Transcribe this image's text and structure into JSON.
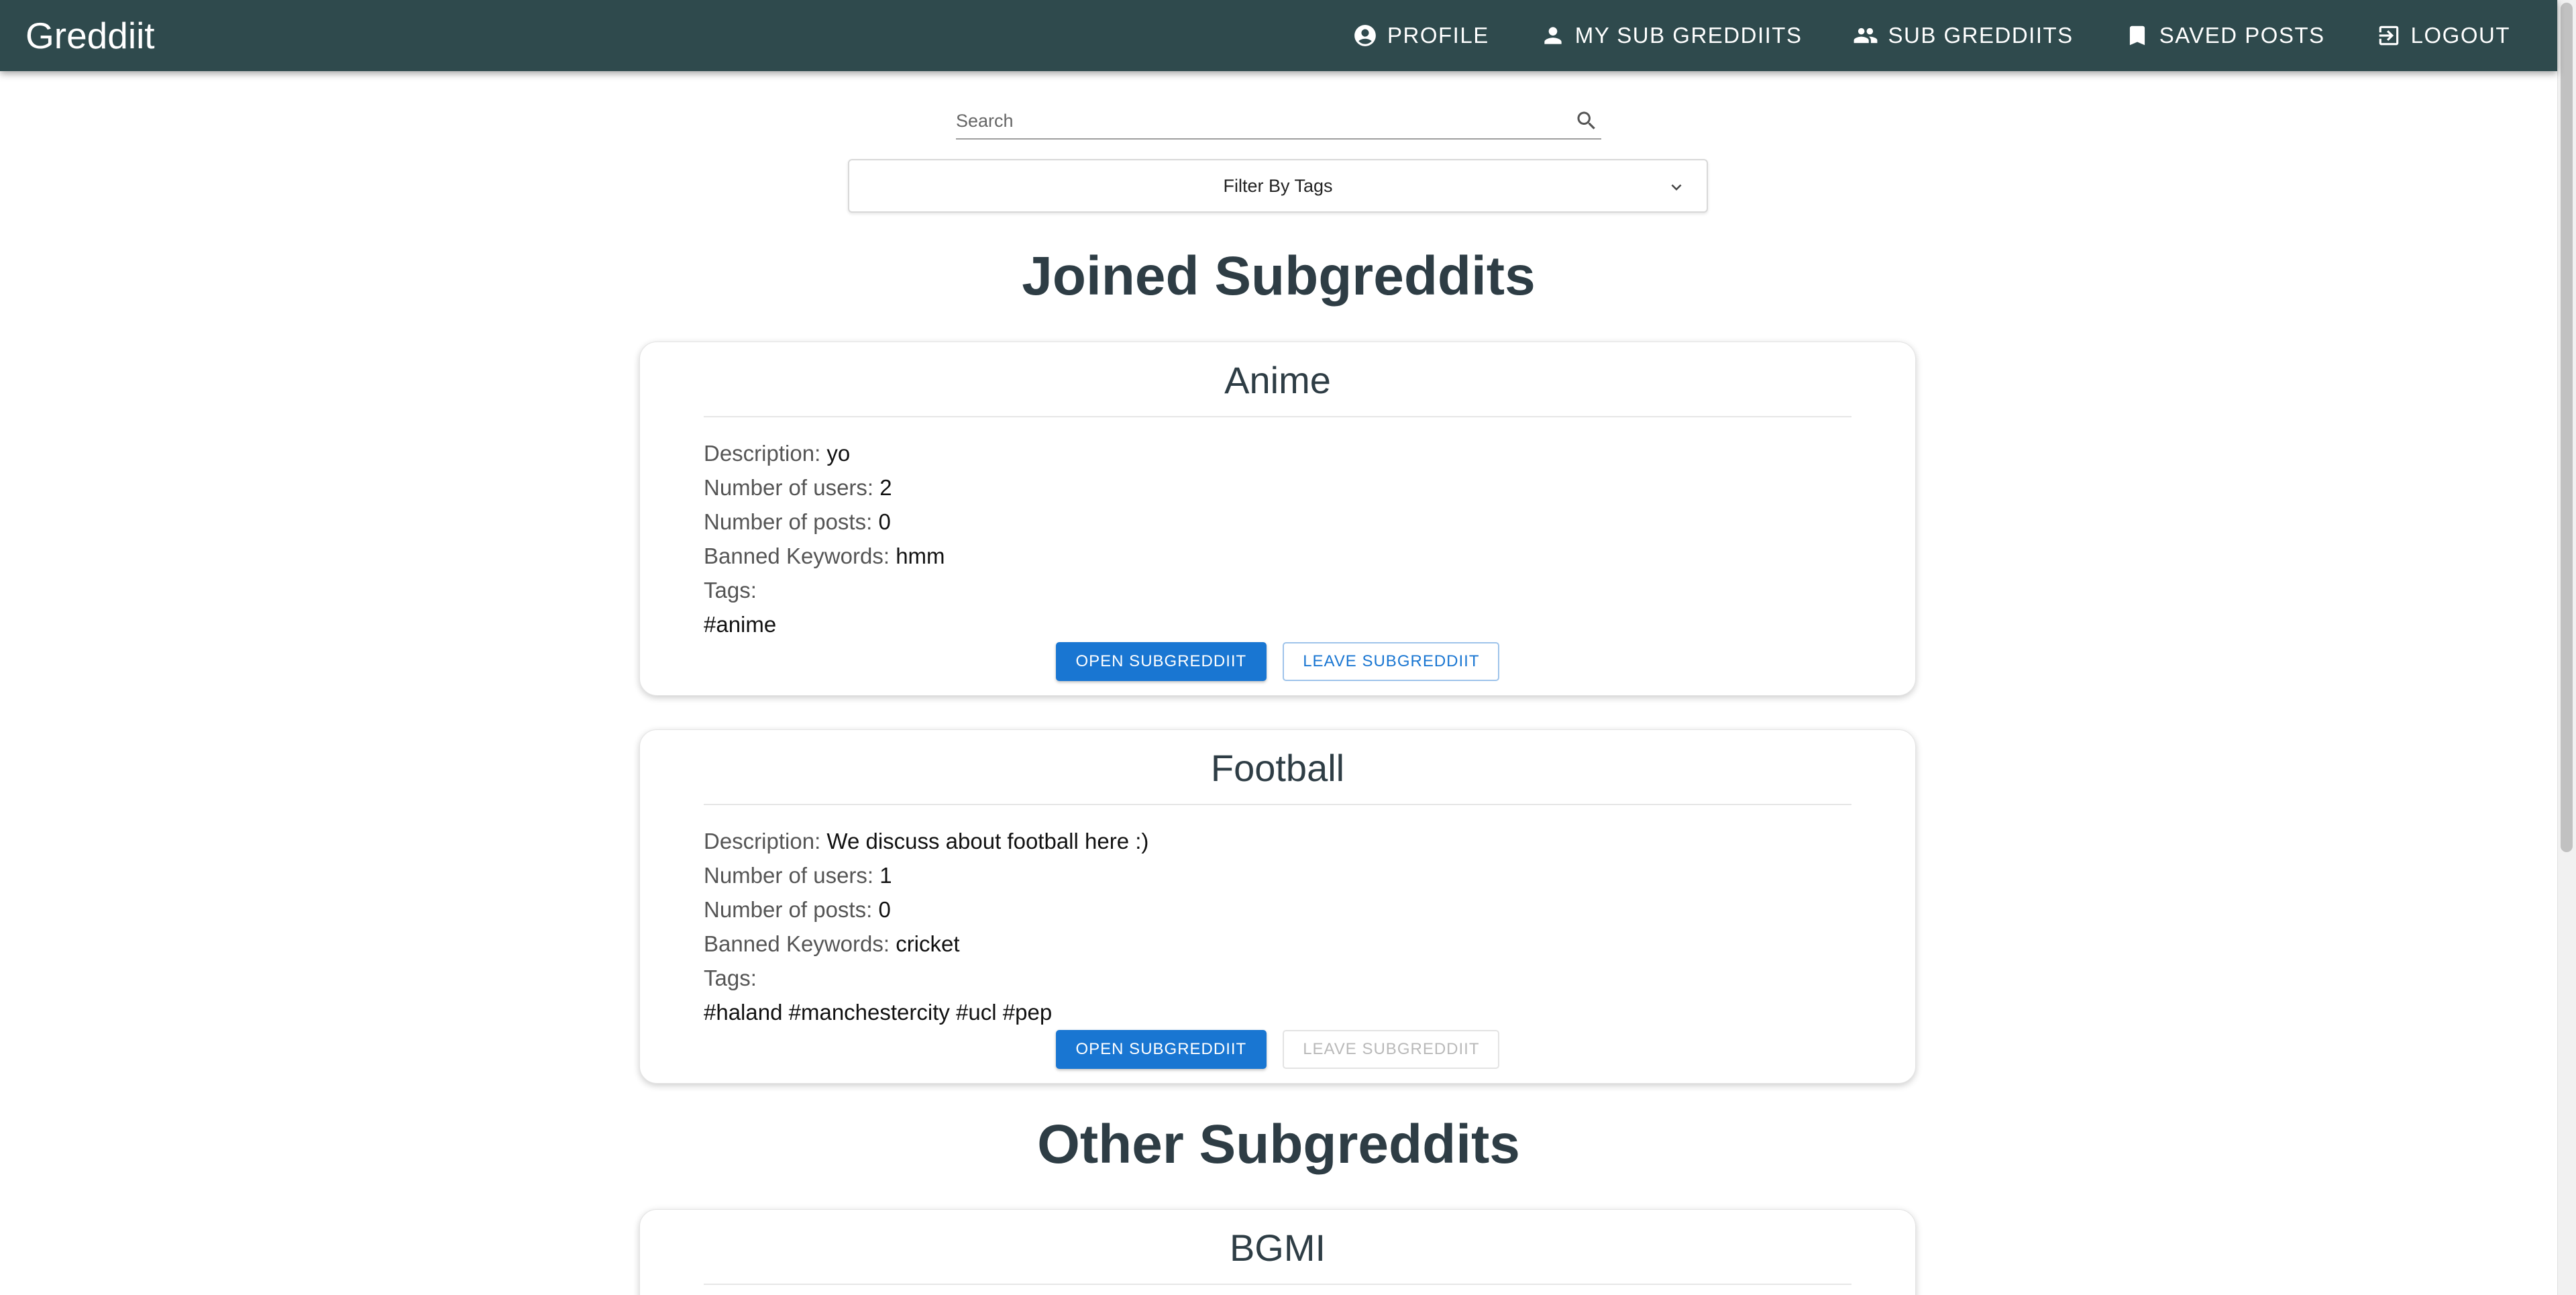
{
  "app": {
    "title": "Greddiit"
  },
  "nav": {
    "items": [
      {
        "label": "PROFILE",
        "icon": "account-circle-icon"
      },
      {
        "label": "MY SUB GREDDIITS",
        "icon": "person-icon"
      },
      {
        "label": "SUB GREDDIITS",
        "icon": "people-icon"
      },
      {
        "label": "SAVED POSTS",
        "icon": "bookmark-icon"
      },
      {
        "label": "LOGOUT",
        "icon": "logout-icon"
      }
    ]
  },
  "search": {
    "placeholder": "Search",
    "value": ""
  },
  "filter": {
    "label": "Filter By Tags"
  },
  "sections": {
    "joined_title": "Joined Subgreddits",
    "other_title": "Other Subgreddits"
  },
  "labels": {
    "description": "Description:",
    "users": "Number of users:",
    "posts": "Number of posts:",
    "banned": "Banned Keywords:",
    "tags": "Tags:",
    "open": "OPEN SUBGREDDIIT",
    "leave": "LEAVE SUBGREDDIIT"
  },
  "joined": [
    {
      "name": "Anime",
      "description": "yo",
      "users": "2",
      "posts": "0",
      "banned": "hmm",
      "tags": "#anime",
      "leave_enabled": true
    },
    {
      "name": "Football",
      "description": "We discuss about football here :)",
      "users": "1",
      "posts": "0",
      "banned": "cricket",
      "tags": "#haland #manchestercity #ucl #pep",
      "leave_enabled": false
    }
  ],
  "other": [
    {
      "name": "BGMI"
    }
  ],
  "colors": {
    "appbar": "#2f4a4d",
    "primary": "#1976d2",
    "heading": "#2e3d45"
  }
}
